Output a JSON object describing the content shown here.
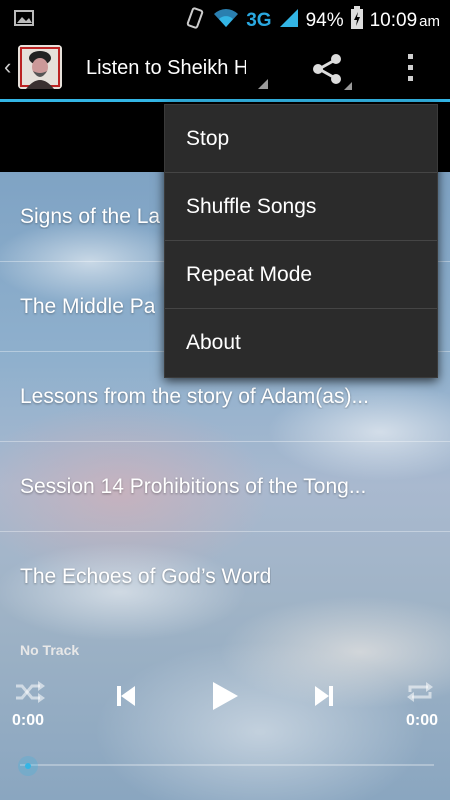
{
  "status_bar": {
    "network": "3G",
    "battery": "94%",
    "time": "10:09",
    "ampm": "am",
    "icons": [
      "screenshot-icon",
      "vibrate-icon",
      "wifi-icon",
      "signal-icon",
      "battery-charging-icon"
    ]
  },
  "action_bar": {
    "title": "Listen to Sheikh H",
    "accent_color": "#33b5e5"
  },
  "songs": [
    "Signs of the La",
    "The Middle Pa",
    "Lessons from the story of Adam(as)...",
    "Session 14 Prohibitions of the Tong...",
    "The Echoes of God’s Word"
  ],
  "menu": {
    "items": [
      "Stop",
      "Shuffle Songs",
      "Repeat Mode",
      "About"
    ]
  },
  "player": {
    "now_playing": "No Track",
    "elapsed": "0:00",
    "duration": "0:00",
    "progress": 0
  }
}
